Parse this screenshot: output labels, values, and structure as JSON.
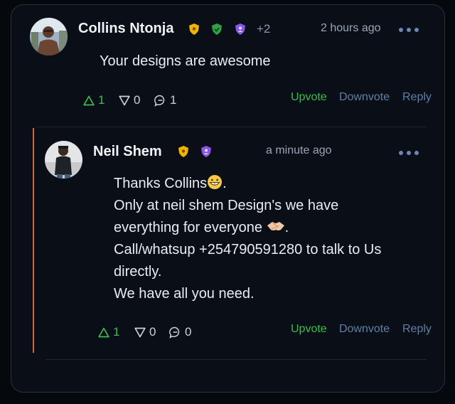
{
  "comment": {
    "author": "Collins Ntonja",
    "badges": [
      "shield-gold",
      "shield-green",
      "shield-purple"
    ],
    "extra_badges": "+2",
    "time": "2 hours ago",
    "text": "Your designs are awesome",
    "upvotes": "1",
    "downvotes": "0",
    "replies": "1",
    "actions": {
      "upvote": "Upvote",
      "downvote": "Downvote",
      "reply": "Reply"
    }
  },
  "reply": {
    "author": "Neil Shem",
    "badges": [
      "shield-gold",
      "shield-purple"
    ],
    "time": "a minute ago",
    "lines": [
      "Thanks Collins",
      ".",
      "Only at neil shem Design's we have",
      "everything for everyone ",
      ".",
      "Call/whatsup +254790591280 to talk to Us",
      "directly.",
      "We have all you need."
    ],
    "upvotes": "1",
    "downvotes": "0",
    "replies": "0",
    "actions": {
      "upvote": "Upvote",
      "downvote": "Downvote",
      "reply": "Reply"
    }
  },
  "colors": {
    "background": "#05080d",
    "card": "#0a0f17",
    "upvote_green": "#3fb950",
    "link_blue": "#5f7ea8",
    "rail_orange": "#c96b42"
  }
}
